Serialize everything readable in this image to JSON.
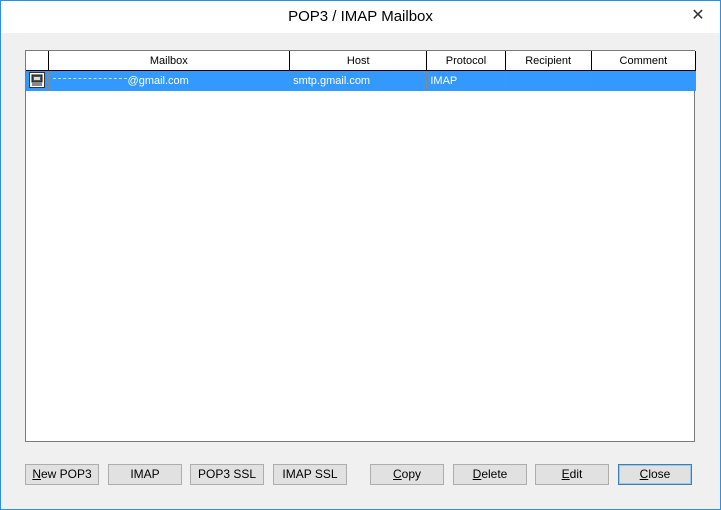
{
  "window": {
    "title": "POP3 / IMAP Mailbox",
    "close_glyph": "✕"
  },
  "table": {
    "columns": [
      "",
      "Mailbox",
      "Host",
      "Protocol",
      "Recipient",
      "Comment"
    ],
    "rows": [
      {
        "icon": "mailbox-icon",
        "mailbox": "@gmail.com",
        "host": "smtp.gmail.com",
        "protocol": "IMAP",
        "recipient": "",
        "comment": ""
      }
    ]
  },
  "buttons": {
    "new_pop3": {
      "ul": "N",
      "rest": "ew POP3"
    },
    "imap": "IMAP",
    "pop3_ssl": "POP3 SSL",
    "imap_ssl": "IMAP SSL",
    "copy": {
      "ul": "C",
      "rest": "opy"
    },
    "delete": {
      "ul": "D",
      "rest": "elete"
    },
    "edit": {
      "ul": "E",
      "rest": "dit"
    },
    "close": {
      "ul": "C",
      "rest": "lose"
    }
  },
  "colors": {
    "selection": "#3399ff",
    "window_border": "#2f8ee6",
    "dialog_bg": "#f0f0f0"
  }
}
